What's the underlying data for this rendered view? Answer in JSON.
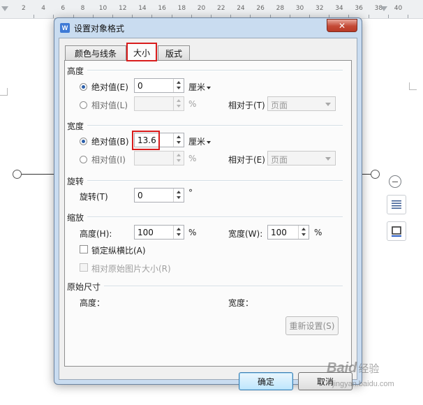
{
  "ruler": {
    "ticks": [
      "2",
      "4",
      "6",
      "8",
      "10",
      "12",
      "14",
      "16",
      "18",
      "20",
      "22",
      "24",
      "26",
      "28",
      "30",
      "32",
      "34",
      "36",
      "38",
      "40"
    ]
  },
  "dialog": {
    "title": "设置对象格式",
    "app_icon": "W",
    "close_label": "✕",
    "tabs": [
      {
        "label": "颜色与线条"
      },
      {
        "label": "大小"
      },
      {
        "label": "版式"
      }
    ],
    "height_section": {
      "title": "高度",
      "absolute_label": "绝对值(E)",
      "absolute_value": "0",
      "absolute_unit": "厘米",
      "relative_label": "相对值(L)",
      "relative_unit": "%",
      "relative_to_label": "相对于(T)",
      "relative_to_value": "页面"
    },
    "width_section": {
      "title": "宽度",
      "absolute_label": "绝对值(B)",
      "absolute_value": "13.6",
      "absolute_unit": "厘米",
      "relative_label": "相对值(I)",
      "relative_unit": "%",
      "relative_to_label": "相对于(E)",
      "relative_to_value": "页面"
    },
    "rotation_section": {
      "title": "旋转",
      "rotation_label": "旋转(T)",
      "rotation_value": "0",
      "rotation_unit": "°"
    },
    "scale_section": {
      "title": "缩放",
      "height_label": "高度(H):",
      "height_value": "100",
      "height_unit": "%",
      "width_label": "宽度(W):",
      "width_value": "100",
      "width_unit": "%",
      "lock_aspect_label": "锁定纵横比(A)",
      "relative_original_label": "相对原始图片大小(R)"
    },
    "original_section": {
      "title": "原始尺寸",
      "height_label": "高度：",
      "width_label": "宽度：",
      "reset_label": "重新设置(S)"
    },
    "ok_label": "确定",
    "cancel_label": "取消"
  },
  "watermark": {
    "brand": "Baid",
    "suffix": "经验",
    "url": "jingyan.baidu.com"
  },
  "colors": {
    "highlight": "#d91c1c",
    "dialog_frame": "#c9dcf0",
    "panel": "#fbfbfb"
  }
}
